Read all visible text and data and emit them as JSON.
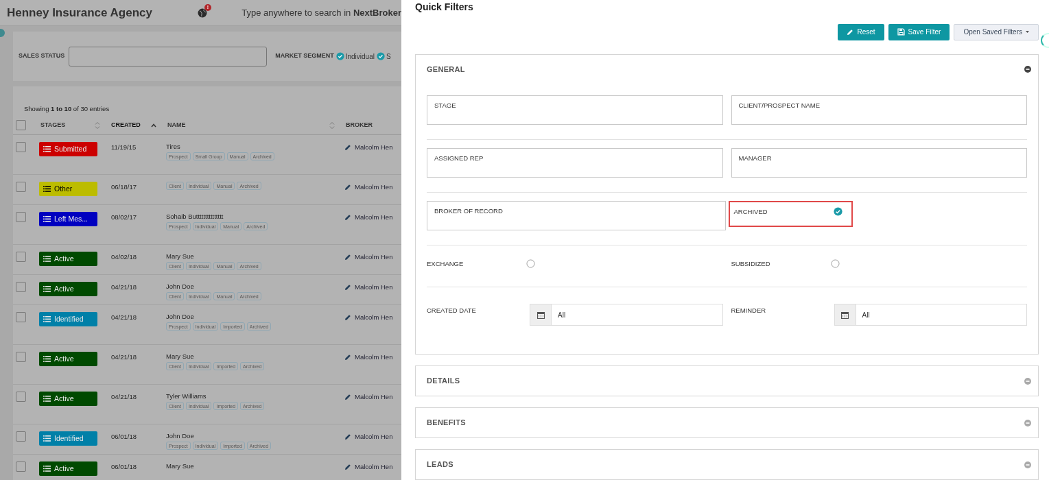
{
  "header": {
    "title": "Henney Insurance Agency",
    "alert_badge": "!",
    "search_placeholder": "Type anywhere to search in **NextBroker**"
  },
  "filter_bar": {
    "sales_status_label": "SALES STATUS",
    "market_segment_label": "MARKET SEGMENT",
    "segments": [
      {
        "label": "Individual",
        "checked": true
      },
      {
        "label": "S",
        "checked": true
      }
    ]
  },
  "table": {
    "info": "Showing **1 to 10** of 30 entries",
    "select_all_checked": false,
    "columns": [
      {
        "label": "STAGES",
        "sorted": false
      },
      {
        "label": "CREATED",
        "sorted": true
      },
      {
        "label": "NAME",
        "sorted": false
      },
      {
        "label": "BROKER",
        "sorted": false
      }
    ],
    "rows": [
      {
        "checked": false,
        "stage": "Submitted",
        "color": "#cc0000",
        "created": "11/19/15",
        "name": "Tires",
        "tags": [
          "Prospect",
          "Small Group",
          "Manual",
          "Archived"
        ],
        "broker": "Malcolm Hen"
      },
      {
        "checked": false,
        "stage": "Other",
        "color": "#bcbc00",
        "created": "06/18/17",
        "tags": [
          "Client",
          "Individual",
          "Manual",
          "Archived"
        ],
        "broker": "Malcolm Hen"
      },
      {
        "checked": false,
        "stage": "Left Mes...",
        "color": "#0000c0",
        "created": "08/02/17",
        "name": "Sohaib Buttttttttttttttt",
        "tags": [
          "Prospect",
          "Individual",
          "Manual",
          "Archived"
        ],
        "broker": "Malcolm Hen"
      },
      {
        "checked": false,
        "stage": "Active",
        "color": "#004a00",
        "created": "04/02/18",
        "name": "Mary Sue",
        "tags": [
          "Client",
          "Individual",
          "Manual",
          "Archived"
        ],
        "broker": "Malcolm Hen"
      },
      {
        "checked": false,
        "stage": "Active",
        "color": "#004a00",
        "created": "04/21/18",
        "name": "John Doe",
        "tags": [
          "Client",
          "Individual",
          "Manual",
          "Archived"
        ],
        "broker": "Malcolm Hen"
      },
      {
        "checked": false,
        "stage": "Identified",
        "color": "#0080a8",
        "created": "04/21/18",
        "name": "John Doe",
        "tags": [
          "Prospect",
          "Individual",
          "Imported",
          "Archived"
        ],
        "broker": "Malcolm Hen"
      },
      {
        "checked": false,
        "stage": "Active",
        "color": "#004a00",
        "created": "04/21/18",
        "name": "Mary Sue",
        "tags": [
          "Client",
          "Individual",
          "Imported",
          "Archived"
        ],
        "broker": "Malcolm Hen"
      },
      {
        "checked": false,
        "stage": "Active",
        "color": "#004a00",
        "created": "04/21/18",
        "name": "Tyler Williams",
        "tags": [
          "Client",
          "Individual",
          "Imported",
          "Archived"
        ],
        "broker": "Malcolm Hen"
      },
      {
        "checked": false,
        "stage": "Identified",
        "color": "#0080a8",
        "created": "06/01/18",
        "name": "John Doe",
        "tags": [
          "Prospect",
          "Individual",
          "Imported",
          "Archived"
        ],
        "broker": "Malcolm Hen"
      },
      {
        "checked": false,
        "stage": "Active",
        "color": "#004a00",
        "created": "06/01/18",
        "name": "Mary Sue",
        "broker": "Malcolm Hen"
      }
    ]
  },
  "panel": {
    "title": "Quick Filters",
    "buttons": [
      {
        "label": "Reset",
        "kind": "primary"
      },
      {
        "label": "Save Filter",
        "kind": "primary"
      },
      {
        "label": "Open Saved Filters",
        "kind": "dropdown"
      }
    ],
    "sections": [
      {
        "title": "GENERAL",
        "expanded": true,
        "rows": [
          [
            {
              "kind": "text",
              "label": "STAGE"
            },
            {
              "kind": "text",
              "label": "CLIENT/PROSPECT NAME"
            }
          ],
          [
            {
              "kind": "text",
              "label": "ASSIGNED REP"
            },
            {
              "kind": "text",
              "label": "MANAGER"
            }
          ],
          [
            {
              "kind": "text",
              "label": "BROKER OF RECORD"
            },
            {
              "kind": "check",
              "label": "ARCHIVED",
              "checked": true,
              "highlighted": true
            }
          ],
          [
            {
              "kind": "check",
              "label": "EXCHANGE",
              "checked": false,
              "highlighted": false
            },
            {
              "kind": "check",
              "label": "SUBSIDIZED",
              "checked": false,
              "highlighted": false
            }
          ],
          [
            {
              "kind": "date",
              "label": "CREATED DATE",
              "value": "All"
            },
            {
              "kind": "date",
              "label": "REMINDER",
              "value": "All"
            }
          ]
        ]
      },
      {
        "title": "DETAILS",
        "expanded": false
      },
      {
        "title": "BENEFITS",
        "expanded": false
      },
      {
        "title": "LEADS",
        "expanded": false
      }
    ]
  }
}
